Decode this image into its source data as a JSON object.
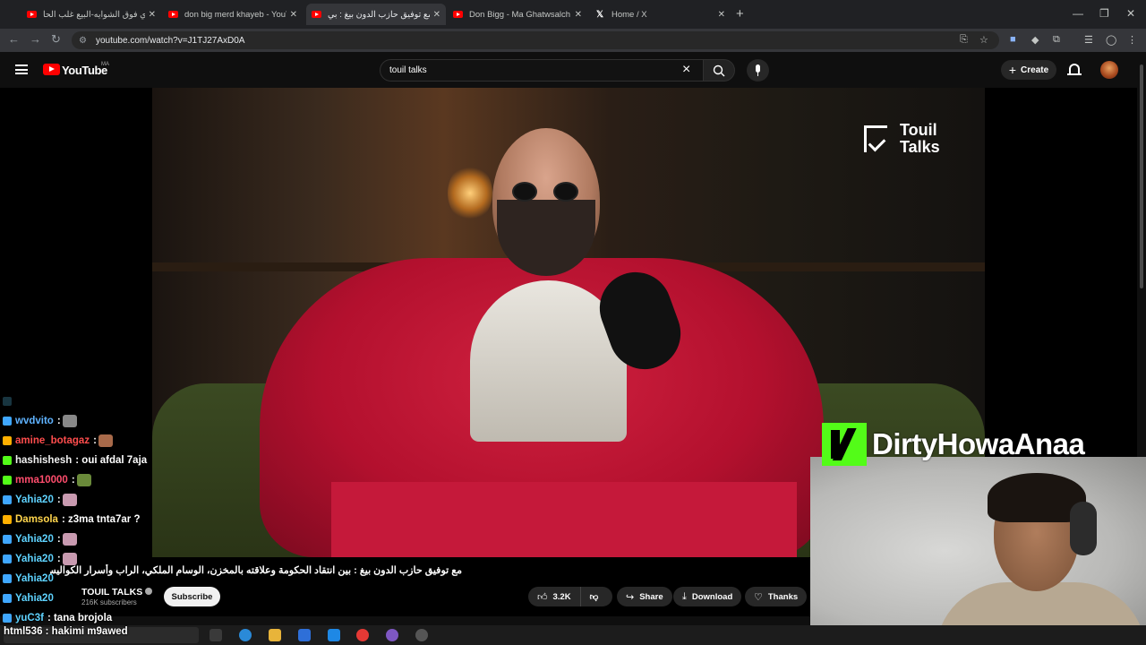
{
  "browser": {
    "tabs": [
      {
        "title": "ديري فوق الشوايه-البيع غلب الحا",
        "active": false,
        "favicon": "youtube-icon"
      },
      {
        "title": "don big merd khayeb - YouTube",
        "active": false,
        "favicon": "youtube-icon"
      },
      {
        "title": "مع توفيق حازب الدون بيغ : بي",
        "active": true,
        "favicon": "youtube-icon"
      },
      {
        "title": "Don Bigg - Ma Ghatwsalch (Offi",
        "active": false,
        "favicon": "youtube-icon"
      },
      {
        "title": "Home / X",
        "active": false,
        "favicon": "x-icon"
      }
    ],
    "url": "youtube.com/watch?v=J1TJ27AxD0A"
  },
  "masthead": {
    "logo_text": "YouTube",
    "country_code": "MA",
    "search_value": "touil talks",
    "create_label": "Create"
  },
  "video": {
    "watermark": "Touil\nTalks",
    "title": "مع توفيق حازب الدون بيغ : بين انتقاد الحكومة وعلاقته بالمخزن، الوسام الملكي، الراب وأسرار الكواليس",
    "channel": "TOUIL TALKS",
    "subscribers": "216K subscribers",
    "subscribe_label": "Subscribe",
    "likes": "3.2K",
    "share_label": "Share",
    "download_label": "Download",
    "thanks_label": "Thanks"
  },
  "stream_overlay": {
    "streamer_name": "DirtyHowaAnaa",
    "brand_color": "#53fc18",
    "chat": [
      {
        "user": "",
        "message": "",
        "color": "#ffffff",
        "faded": true
      },
      {
        "user": "wvdvito",
        "message": ":",
        "color": "#5fb3ff",
        "emote": true
      },
      {
        "user": "amine_botagaz",
        "message": ":",
        "color": "#ff4d4d",
        "emote": true
      },
      {
        "user": "hashishesh",
        "message": ": oui afdal 7aja",
        "color": "#ffffff"
      },
      {
        "user": "mma10000",
        "message": ":",
        "color": "#ff4d6d",
        "emote": true
      },
      {
        "user": "Yahia20",
        "message": ":",
        "color": "#5fd3ff",
        "emote": true
      },
      {
        "user": "Damsola",
        "message": ": z3ma tnta7ar ?",
        "color": "#ffd54d"
      },
      {
        "user": "Yahia20",
        "message": ":",
        "color": "#5fd3ff",
        "emote": true
      },
      {
        "user": "Yahia20",
        "message": ":",
        "color": "#5fd3ff",
        "emote": true
      },
      {
        "user": "Yahia20",
        "message": "",
        "color": "#5fd3ff"
      },
      {
        "user": "Yahia20",
        "message": "",
        "color": "#5fd3ff"
      },
      {
        "user": "yuC3f",
        "message": ": tana brojola",
        "color": "#5fd3ff"
      }
    ],
    "bottom_line": "html536 : hakimi m9awed"
  }
}
